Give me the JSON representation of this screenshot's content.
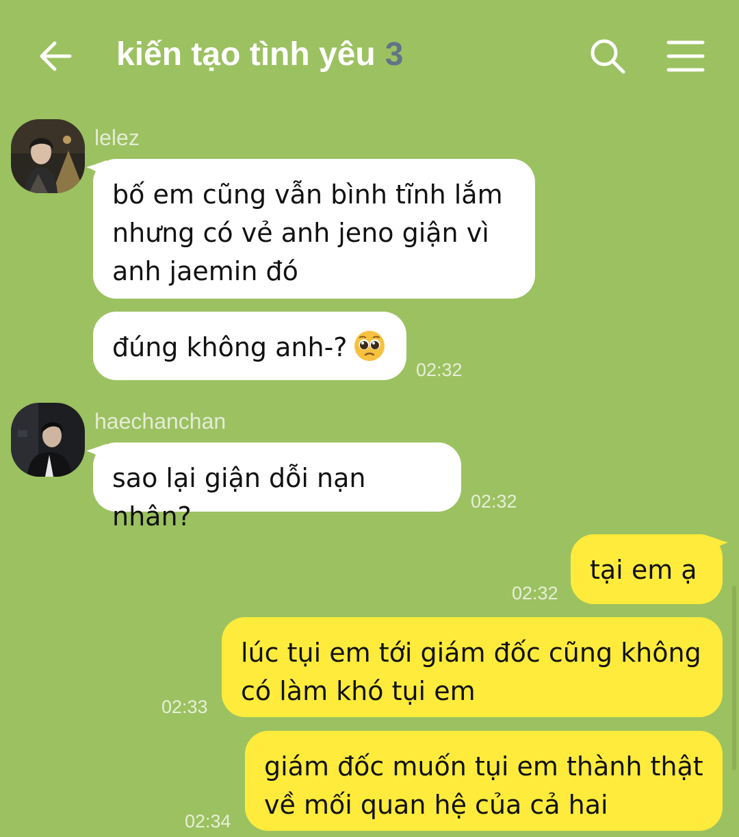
{
  "header": {
    "title": "kiến tạo tình yêu",
    "member_count": "3",
    "back_icon": "arrow-left-icon",
    "search_icon": "search-icon",
    "menu_icon": "hamburger-menu-icon"
  },
  "colors": {
    "background": "#9cc161",
    "incoming_bubble": "#ffffff",
    "outgoing_bubble": "#ffeb3b"
  },
  "messages": [
    {
      "sender": "lelez",
      "lines": [
        "bố em cũng vẫn bình tĩnh lắm",
        "nhưng có vẻ anh jeno giận vì",
        "anh jaemin đó"
      ]
    },
    {
      "text": "đúng không anh-?",
      "emoji": "pleading-face-emoji",
      "time": "02:32"
    },
    {
      "sender": "haechanchan",
      "text": "sao lại giận dỗi nạn nhân?",
      "time": "02:32"
    },
    {
      "text": "tại em ạ",
      "time": "02:32"
    },
    {
      "lines": [
        "lúc tụi em tới giám đốc cũng không",
        "có làm khó tụi em"
      ],
      "time": "02:33"
    },
    {
      "lines": [
        "giám đốc muốn tụi em thành thật",
        "về mối quan hệ của cả hai"
      ],
      "time": "02:34"
    }
  ]
}
